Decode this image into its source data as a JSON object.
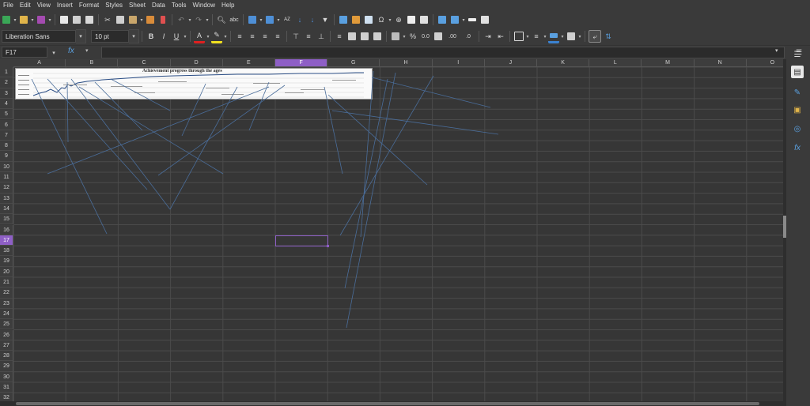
{
  "menu": [
    "File",
    "Edit",
    "View",
    "Insert",
    "Format",
    "Styles",
    "Sheet",
    "Data",
    "Tools",
    "Window",
    "Help"
  ],
  "format_bar": {
    "font_name": "Liberation Sans",
    "font_size": "10 pt",
    "bold": "B",
    "italic": "I",
    "underline": "U",
    "percent": "%",
    "decimal_number": "0.0",
    "add_decimal": ".00",
    "remove_decimal": ".0"
  },
  "formula_bar": {
    "name_box": "F17",
    "formula": ""
  },
  "columns": [
    "A",
    "B",
    "C",
    "D",
    "E",
    "F",
    "G",
    "H",
    "I",
    "J",
    "K",
    "L",
    "M",
    "N",
    "O"
  ],
  "rows": [
    "1",
    "2",
    "3",
    "4",
    "5",
    "6",
    "7",
    "8",
    "9",
    "10",
    "11",
    "12",
    "13",
    "14",
    "15",
    "16",
    "17",
    "18",
    "19",
    "20",
    "21",
    "22",
    "23",
    "24",
    "25",
    "26",
    "27",
    "28",
    "29",
    "30",
    "31",
    "32"
  ],
  "active_cell": {
    "column": "F",
    "row": "17"
  },
  "embedded_image": {
    "title": "Achievement progress through the ages"
  },
  "colors": {
    "accent": "#8e5fc6",
    "line": "#4a6d9a",
    "background": "#363636"
  },
  "sidebar_icons": [
    "menu-icon",
    "properties-icon",
    "styles-icon",
    "gallery-icon",
    "navigator-icon",
    "functions-icon"
  ]
}
